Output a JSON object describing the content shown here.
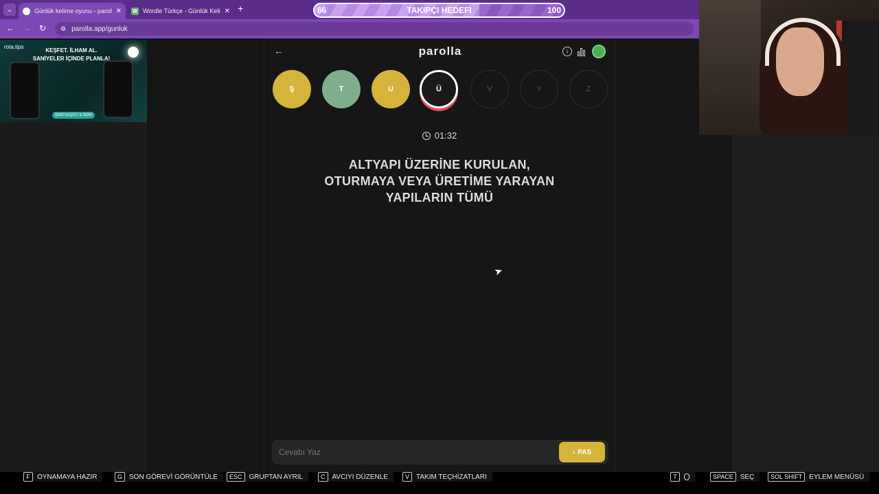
{
  "browser": {
    "tabs": [
      {
        "title": "Günlük kelime oyunu - parolla",
        "close": "✕"
      },
      {
        "title": "Wordle Türkçe - Günlük Kelime",
        "close": "✕",
        "favicon": "W"
      }
    ],
    "new_tab": "+",
    "url": "parolla.app/gunluk",
    "accent": "#5b2d8a"
  },
  "goal": {
    "current": "66",
    "label": "TAKIPÇI HEDEFI",
    "target": "100",
    "progress": 0.66
  },
  "ad": {
    "logo": "rota.tips",
    "headline_1": "KEŞFET. İLHAM AL.",
    "headline_2": "SANİYELER İÇİNDE PLANLA!",
    "cta": "ŞİMDİ KEŞFET & İNDİR"
  },
  "game": {
    "brand": "parolla",
    "letters": [
      {
        "char": "Ş",
        "state": "yellow"
      },
      {
        "char": "T",
        "state": "green"
      },
      {
        "char": "U",
        "state": "yellow"
      },
      {
        "char": "Ü",
        "state": "current"
      },
      {
        "char": "V",
        "state": "empty"
      },
      {
        "char": "Y",
        "state": "empty"
      },
      {
        "char": "Z",
        "state": "empty"
      }
    ],
    "timer": "01:32",
    "clue_lines": [
      "ALTYAPI ÜZERİNE KURULAN,",
      "OTURMAYA VEYA ÜRETİME YARAYAN",
      "YAPILARIN TÜMÜ"
    ],
    "answer_placeholder": "Cevabı Yaz",
    "pass_label": "PAS",
    "colors": {
      "yellow": "#d4b43a",
      "green": "#7fae8c",
      "current_ring": "#e04a5a"
    }
  },
  "hints": [
    {
      "key": "F",
      "label": "OYNAMAYA HAZIR"
    },
    {
      "key": "G",
      "label": "SON GÖREVİ GÖRÜNTÜLE"
    },
    {
      "key": "ESC",
      "label": "GRUPTAN AYRIL"
    },
    {
      "key": "C",
      "label": "AVCIYI DÜZENLE"
    },
    {
      "key": "V",
      "label": "TAKIM TEÇHİZATLARI"
    },
    {
      "key": "T",
      "label": ""
    },
    {
      "key": "SPACE",
      "label": "SEÇ"
    },
    {
      "key": "SOL SHIFT",
      "label": "EYLEM MENÜSÜ"
    }
  ]
}
